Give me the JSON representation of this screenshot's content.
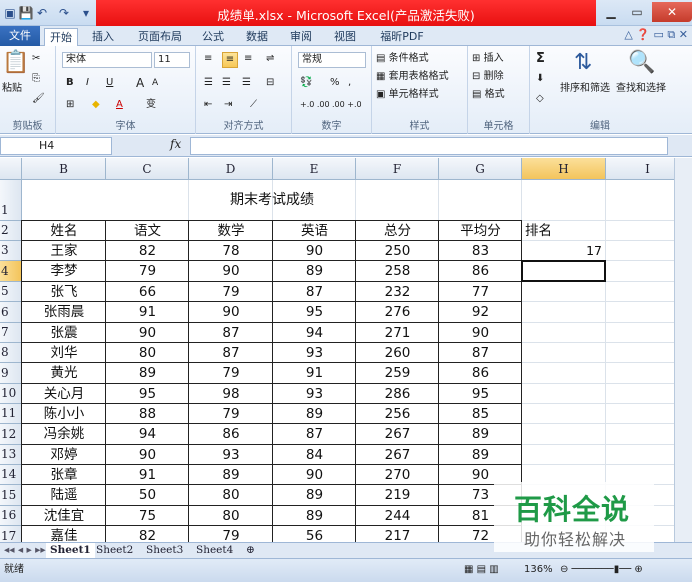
{
  "window": {
    "title": "成绩单.xlsx - Microsoft Excel(产品激活失败)"
  },
  "tabs": [
    "文件",
    "开始",
    "插入",
    "页面布局",
    "公式",
    "数据",
    "审阅",
    "视图",
    "福昕PDF"
  ],
  "ribbon": {
    "clipboard": {
      "label": "剪贴板",
      "paste": "粘贴"
    },
    "font": {
      "label": "字体",
      "name": "宋体",
      "size": "11",
      "bold": "B",
      "italic": "I",
      "underline": "U",
      "grow": "A",
      "shrink": "A",
      "color": "A",
      "phonetic": "变"
    },
    "align": {
      "label": "对齐方式"
    },
    "number": {
      "label": "数字",
      "format": "常规",
      "percent": "%",
      "comma": ",",
      "inc": "+.0 .00",
      "dec": ".00 +.0"
    },
    "styles": {
      "label": "样式",
      "cond": "条件格式",
      "table": "套用表格格式",
      "cell": "单元格样式"
    },
    "cells": {
      "label": "单元格",
      "insert": "插入",
      "delete": "删除",
      "format": "格式"
    },
    "edit": {
      "label": "编辑",
      "sum": "Σ",
      "sort": "排序和筛选",
      "find": "查找和选择"
    }
  },
  "formula": {
    "namebox": "H4",
    "fx": "fx"
  },
  "columns": [
    "B",
    "C",
    "D",
    "E",
    "F",
    "G",
    "H",
    "I"
  ],
  "rows": [
    "1",
    "2",
    "3",
    "4",
    "5",
    "6",
    "7",
    "8",
    "9",
    "10",
    "11",
    "12",
    "13",
    "14",
    "15",
    "16",
    "17"
  ],
  "sheet": {
    "title": "期末考试成绩",
    "headers": [
      "姓名",
      "语文",
      "数学",
      "英语",
      "总分",
      "平均分"
    ],
    "rank_header": "排名",
    "rank_value": "17",
    "data": [
      [
        "王家",
        "82",
        "78",
        "90",
        "250",
        "83"
      ],
      [
        "李梦",
        "79",
        "90",
        "89",
        "258",
        "86"
      ],
      [
        "张飞",
        "66",
        "79",
        "87",
        "232",
        "77"
      ],
      [
        "张雨晨",
        "91",
        "90",
        "95",
        "276",
        "92"
      ],
      [
        "张震",
        "90",
        "87",
        "94",
        "271",
        "90"
      ],
      [
        "刘华",
        "80",
        "87",
        "93",
        "260",
        "87"
      ],
      [
        "黄光",
        "89",
        "79",
        "91",
        "259",
        "86"
      ],
      [
        "关心月",
        "95",
        "98",
        "93",
        "286",
        "95"
      ],
      [
        "陈小小",
        "88",
        "79",
        "89",
        "256",
        "85"
      ],
      [
        "冯余姚",
        "94",
        "86",
        "87",
        "267",
        "89"
      ],
      [
        "邓婷",
        "90",
        "93",
        "84",
        "267",
        "89"
      ],
      [
        "张章",
        "91",
        "89",
        "90",
        "270",
        "90"
      ],
      [
        "陆遥",
        "50",
        "80",
        "89",
        "219",
        "73"
      ],
      [
        "沈佳宜",
        "75",
        "80",
        "89",
        "244",
        "81"
      ],
      [
        "嘉佳",
        "82",
        "79",
        "56",
        "217",
        "72"
      ]
    ]
  },
  "sheets": [
    "Sheet1",
    "Sheet2",
    "Sheet3",
    "Sheet4"
  ],
  "status": {
    "ready": "就绪",
    "zoom": "136%"
  },
  "watermark": {
    "line1": "百科全说",
    "line2": "助你轻松解决"
  }
}
